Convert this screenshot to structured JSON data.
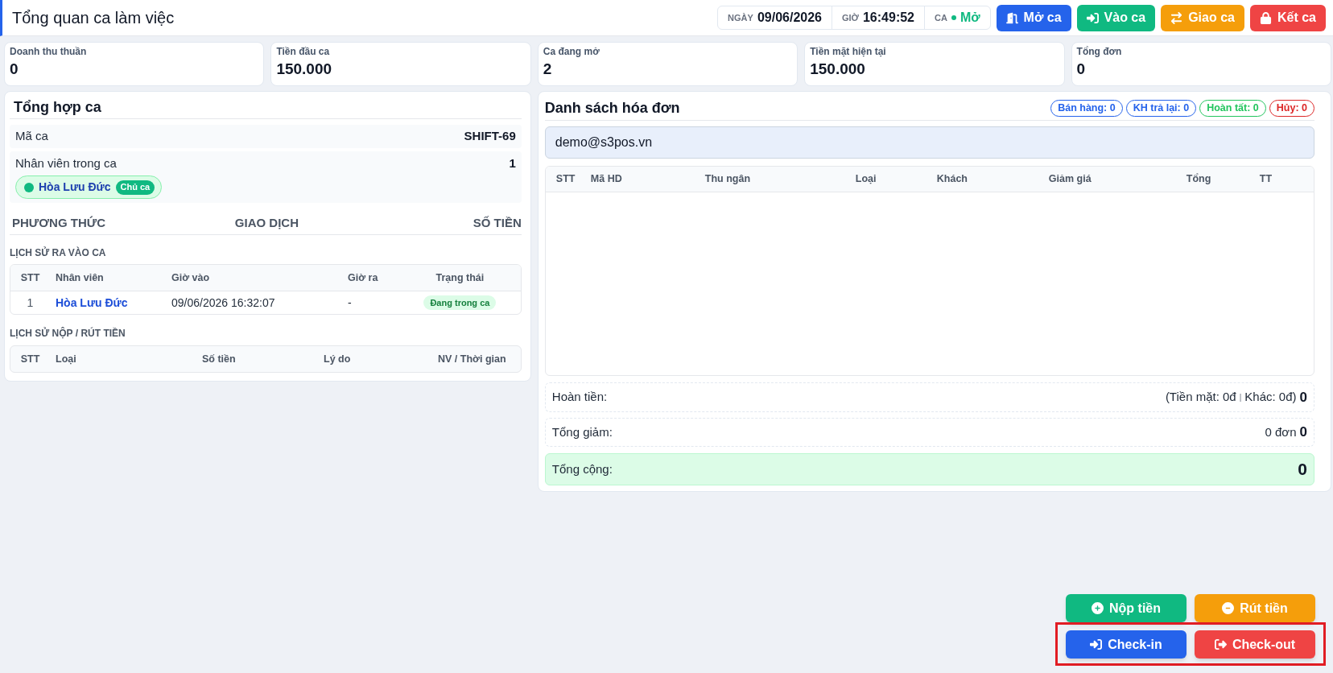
{
  "header": {
    "title": "Tổng quan ca làm việc",
    "info": [
      {
        "label": "NGÀY",
        "value": "09/06/2026"
      },
      {
        "label": "GIỜ",
        "value": "16:49:52"
      }
    ],
    "shift_status": {
      "label": "CA",
      "value": "Mở",
      "open": true
    },
    "buttons": [
      {
        "label": "Mở ca",
        "kind": "open"
      },
      {
        "label": "Vào ca",
        "kind": "join"
      },
      {
        "label": "Giao ca",
        "kind": "handover"
      },
      {
        "label": "Kết ca",
        "kind": "close"
      }
    ]
  },
  "stats": [
    {
      "label": "Doanh thu thuần",
      "value": "0"
    },
    {
      "label": "Tiền đầu ca",
      "value": "150.000"
    },
    {
      "label": "Ca đang mở",
      "value": "2"
    },
    {
      "label": "Tiền mặt hiện tại",
      "value": "150.000"
    },
    {
      "label": "Tổng đơn",
      "value": "0"
    }
  ],
  "shift_summary": {
    "title": "Tổng hợp ca",
    "shift_code": {
      "label": "Mã ca",
      "value": "SHIFT-69"
    },
    "staff": {
      "label": "Nhân viên trong ca",
      "count": "1",
      "members": [
        {
          "name": "Hòa Lưu Đức",
          "role": "Chủ ca",
          "online": true
        }
      ]
    },
    "method_columns": [
      "PHƯƠNG THỨC",
      "GIAO DỊCH",
      "SỐ TIỀN"
    ],
    "checkin_history": {
      "title": "LỊCH SỬ RA VÀO CA",
      "columns": [
        "STT",
        "Nhân viên",
        "Giờ vào",
        "Giờ ra",
        "Trạng thái"
      ],
      "rows": [
        {
          "stt": "1",
          "staff": "Hòa Lưu Đức",
          "time_in": "09/06/2026 16:32:07",
          "time_out": "-",
          "status": "Đang trong ca"
        }
      ]
    },
    "cash_history": {
      "title": "LỊCH SỬ NỘP / RÚT TIỀN",
      "columns": [
        "STT",
        "Loại",
        "Số tiền",
        "Lý do",
        "NV / Thời gian"
      ]
    }
  },
  "invoices": {
    "title": "Danh sách hóa đơn",
    "counters": [
      {
        "label": "Bán hàng: 0",
        "color": "#2563eb"
      },
      {
        "label": "KH trả lại: 0",
        "color": "#2563eb"
      },
      {
        "label": "Hoàn tất: 0",
        "color": "#22c55e"
      },
      {
        "label": "Hủy: 0",
        "color": "#dc2626"
      }
    ],
    "search": {
      "value": "demo@s3pos.vn"
    },
    "columns": [
      "STT",
      "Mã HD",
      "Thu ngân",
      "Loại",
      "Khách",
      "Giảm giá",
      "Tổng",
      "TT"
    ],
    "refund": {
      "label": "Hoàn tiền:",
      "cash": "(Tiền mặt: 0đ",
      "separator": "|",
      "other": "Khác: 0đ)",
      "total": "0"
    },
    "discount": {
      "label": "Tổng giảm:",
      "orders": "0 đơn",
      "total": "0"
    },
    "grand_total": {
      "label": "Tổng cộng:",
      "total": "0"
    }
  },
  "bottom_actions": [
    {
      "highlighted": false,
      "buttons": [
        {
          "label": "Nộp tiền",
          "kind": "deposit"
        },
        {
          "label": "Rút tiền",
          "kind": "withdraw"
        }
      ]
    },
    {
      "highlighted": true,
      "buttons": [
        {
          "label": "Check-in",
          "kind": "check_in"
        },
        {
          "label": "Check-out",
          "kind": "check_out"
        }
      ]
    }
  ]
}
